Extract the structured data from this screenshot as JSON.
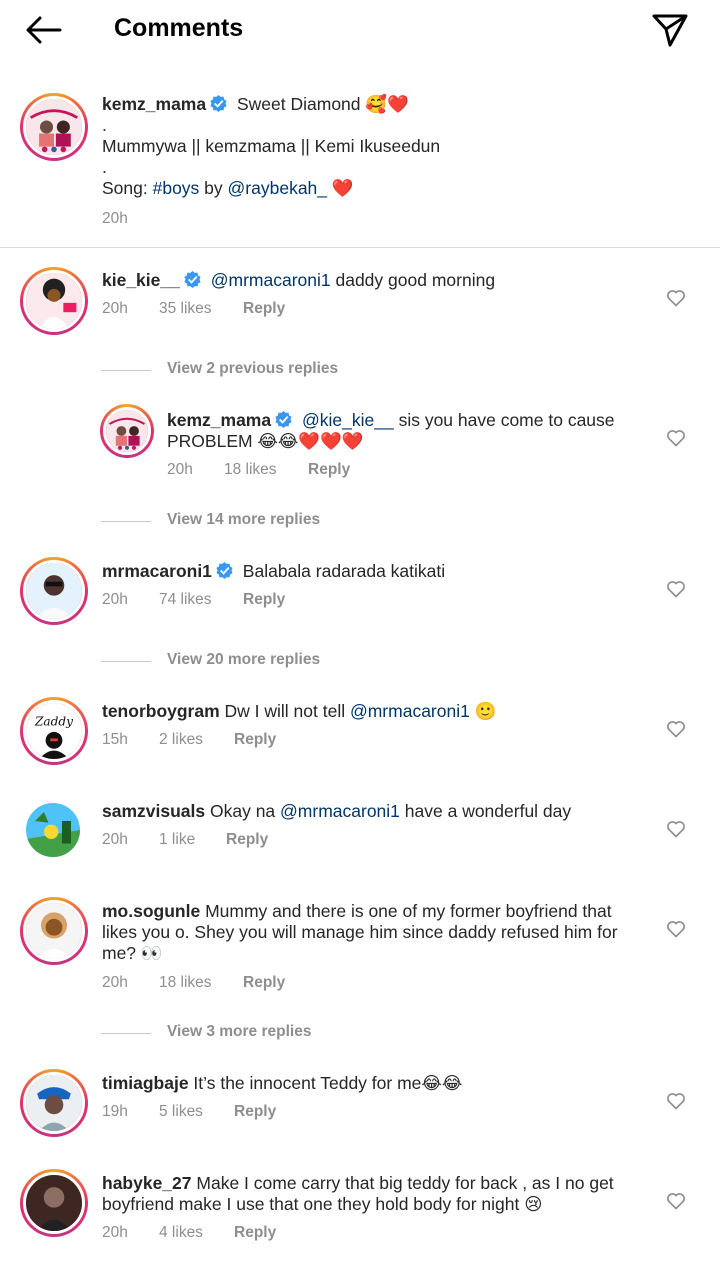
{
  "header": {
    "title": "Comments"
  },
  "caption": {
    "username": "kemz_mama",
    "line1": "Sweet Diamond 🥰❤️",
    "dot1": ".",
    "line2": "Mummywa || kemzmama || Kemi Ikuseedun",
    "dot2": ".",
    "song_prefix": "Song: ",
    "song_tag": "#boys",
    "song_by": " by ",
    "song_mention": "@raybekah_",
    "song_suffix": " ❤️",
    "time": "20h"
  },
  "comments": [
    {
      "username": "kie_kie__",
      "mention": "@mrmacaroni1",
      "text": " daddy good morning",
      "time": "20h",
      "likes": "35 likes",
      "reply": "Reply"
    },
    {
      "username": "kemz_mama",
      "mention": "@kie_kie__",
      "text": " sis you have come to cause PROBLEM 😂😂❤️❤️❤️",
      "time": "20h",
      "likes": "18 likes",
      "reply": "Reply"
    },
    {
      "username": "mrmacaroni1",
      "text": "Balabala radarada katikati",
      "time": "20h",
      "likes": "74 likes",
      "reply": "Reply"
    },
    {
      "username": "tenorboygram",
      "text": " Dw I will not tell ",
      "mention": "@mrmacaroni1",
      "text2": " 🙂",
      "time": "15h",
      "likes": "2 likes",
      "reply": "Reply"
    },
    {
      "username": "samzvisuals",
      "text": " Okay na ",
      "mention": "@mrmacaroni1",
      "text2": " have a wonderful day",
      "time": "20h",
      "likes": "1 like",
      "reply": "Reply"
    },
    {
      "username": "mo.sogunle",
      "text": " Mummy and there is one of my former boyfriend that likes you o. Shey you will manage him since daddy refused him for me? 👀",
      "time": "20h",
      "likes": "18 likes",
      "reply": "Reply"
    },
    {
      "username": "timiagbaje",
      "text": " It’s the innocent Teddy for me😂😂",
      "time": "19h",
      "likes": "5 likes",
      "reply": "Reply"
    },
    {
      "username": "habyke_27",
      "text": " Make I come carry that big teddy for back , as I no get boyfriend make I use that one they hold body for night 😢",
      "time": "20h",
      "likes": "4 likes",
      "reply": "Reply"
    }
  ],
  "view_replies": {
    "previous_2": "View 2 previous replies",
    "more_14": "View 14 more replies",
    "more_20": "View 20 more replies",
    "more_3": "View 3 more replies"
  },
  "colors": {
    "link": "#003569",
    "meta": "#8e8e8e",
    "verified": "#3897f0"
  }
}
